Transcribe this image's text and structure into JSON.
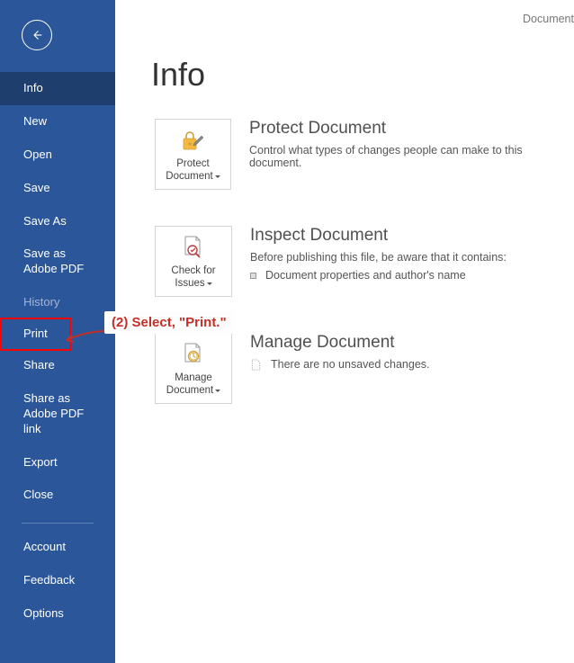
{
  "doc_title": "Document",
  "page_title": "Info",
  "sidebar": {
    "items": [
      {
        "label": "Info",
        "active": true
      },
      {
        "label": "New"
      },
      {
        "label": "Open"
      },
      {
        "label": "Save"
      },
      {
        "label": "Save As"
      },
      {
        "label": "Save as Adobe PDF"
      },
      {
        "label": "History",
        "dim": true
      },
      {
        "label": "Print",
        "highlight": true
      },
      {
        "label": "Share"
      },
      {
        "label": "Share as Adobe PDF link"
      },
      {
        "label": "Export"
      },
      {
        "label": "Close"
      }
    ],
    "footer": [
      {
        "label": "Account"
      },
      {
        "label": "Feedback"
      },
      {
        "label": "Options"
      }
    ]
  },
  "sections": {
    "protect": {
      "tile": "Protect Document",
      "title": "Protect Document",
      "desc": "Control what types of changes people can make to this document."
    },
    "inspect": {
      "tile": "Check for Issues",
      "title": "Inspect Document",
      "desc": "Before publishing this file, be aware that it contains:",
      "bullet": "Document properties and author's name"
    },
    "manage": {
      "tile": "Manage Document",
      "title": "Manage Document",
      "desc": "There are no unsaved changes."
    }
  },
  "annotation": "(2) Select, \"Print.\""
}
